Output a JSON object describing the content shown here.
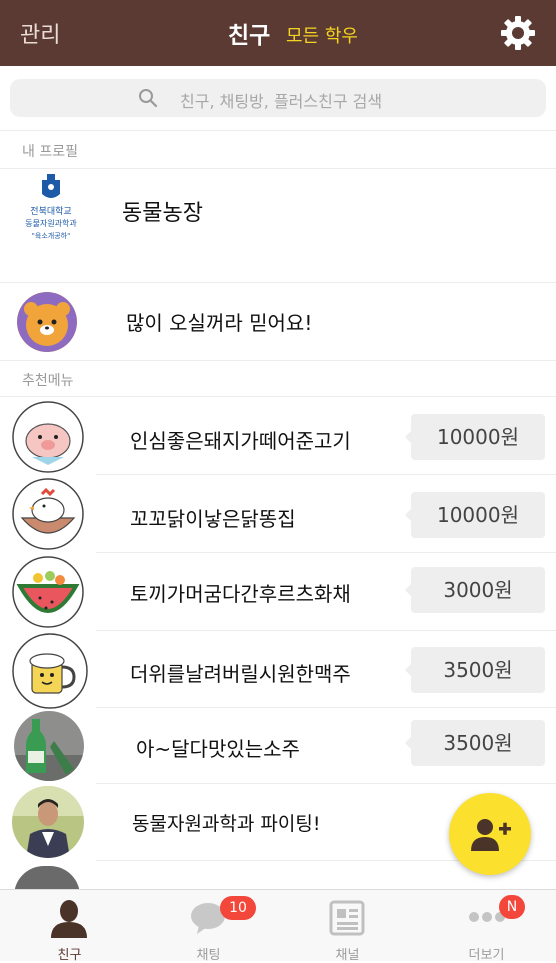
{
  "header": {
    "manage_label": "관리",
    "title": "친구",
    "subtitle": "모든 학우"
  },
  "search": {
    "placeholder": "친구, 채팅방, 플러스친구 검색"
  },
  "sections": {
    "my_profile": "내 프로필",
    "recommended": "추천메뉴"
  },
  "profile": {
    "name": "동물농장",
    "logo_lines": [
      "전북대학교",
      "동물자원과학과",
      "\"육소개공하\""
    ]
  },
  "status_row": {
    "message": "많이 오실꺼라 믿어요!"
  },
  "menu": [
    {
      "name": "인심좋은돼지가떼어준고기",
      "price": "10000원"
    },
    {
      "name": "꼬꼬닭이낳은닭똥집",
      "price": "10000원"
    },
    {
      "name": "토끼가머굼다간후르츠화채",
      "price": "3000원"
    },
    {
      "name": "더위를날려버릴시원한맥주",
      "price": "3500원"
    },
    {
      "name": "아~달다맛있는소주",
      "price": "3500원"
    },
    {
      "name": "동물자원과학과 파이팅!",
      "price": ""
    }
  ],
  "tabs": [
    {
      "label": "친구",
      "icon": "person-icon",
      "badge": ""
    },
    {
      "label": "채팅",
      "icon": "speech-bubble-icon",
      "badge": "10"
    },
    {
      "label": "채널",
      "icon": "newspaper-icon",
      "badge": ""
    },
    {
      "label": "더보기",
      "icon": "more-dots-icon",
      "badge": "N"
    }
  ],
  "colors": {
    "header_bg": "#5a3a33",
    "accent_yellow": "#f5d321",
    "fab_yellow": "#fbe02d",
    "badge_red": "#f2473a"
  }
}
